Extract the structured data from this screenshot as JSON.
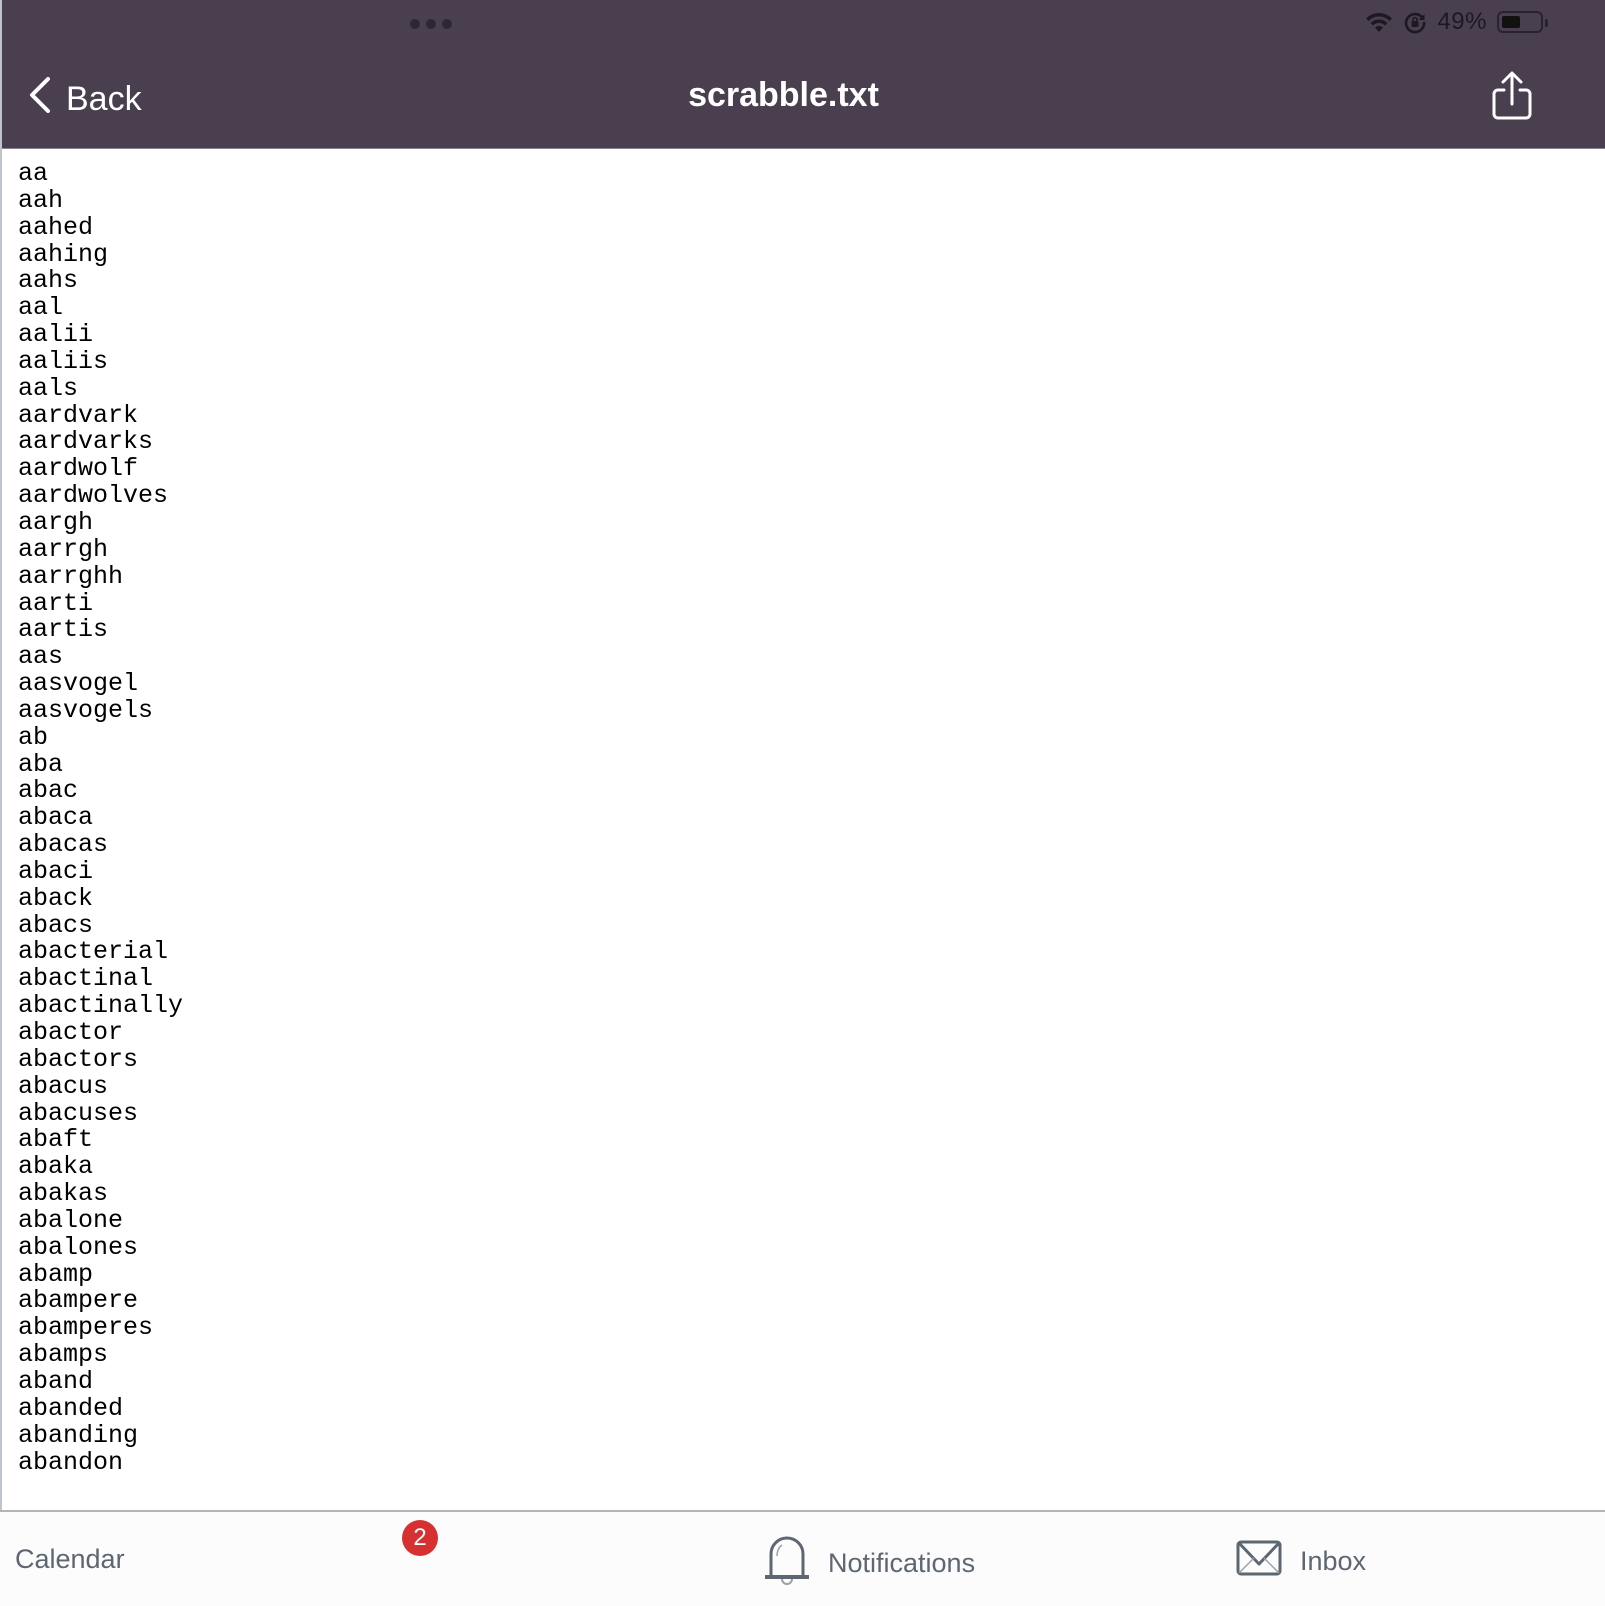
{
  "status_bar": {
    "battery_percent": "49%",
    "battery_level": 0.49,
    "icons": [
      "wifi-icon",
      "orientation-lock-icon",
      "battery-icon"
    ]
  },
  "nav": {
    "back_label": "Back",
    "title": "scrabble.txt",
    "share_icon": "share-icon"
  },
  "file": {
    "words": [
      "aa",
      "aah",
      "aahed",
      "aahing",
      "aahs",
      "aal",
      "aalii",
      "aaliis",
      "aals",
      "aardvark",
      "aardvarks",
      "aardwolf",
      "aardwolves",
      "aargh",
      "aarrgh",
      "aarrghh",
      "aarti",
      "aartis",
      "aas",
      "aasvogel",
      "aasvogels",
      "ab",
      "aba",
      "abac",
      "abaca",
      "abacas",
      "abaci",
      "aback",
      "abacs",
      "abacterial",
      "abactinal",
      "abactinally",
      "abactor",
      "abactors",
      "abacus",
      "abacuses",
      "abaft",
      "abaka",
      "abakas",
      "abalone",
      "abalones",
      "abamp",
      "abampere",
      "abamperes",
      "abamps",
      "aband",
      "abanded",
      "abanding",
      "abandon"
    ]
  },
  "tab_bar": {
    "calendar_label": "Calendar",
    "badge_count": "2",
    "notifications_label": "Notifications",
    "inbox_label": "Inbox"
  },
  "colors": {
    "header_bg": "#4a3f4e",
    "badge_bg": "#d63030",
    "tab_text": "#5d6671"
  }
}
